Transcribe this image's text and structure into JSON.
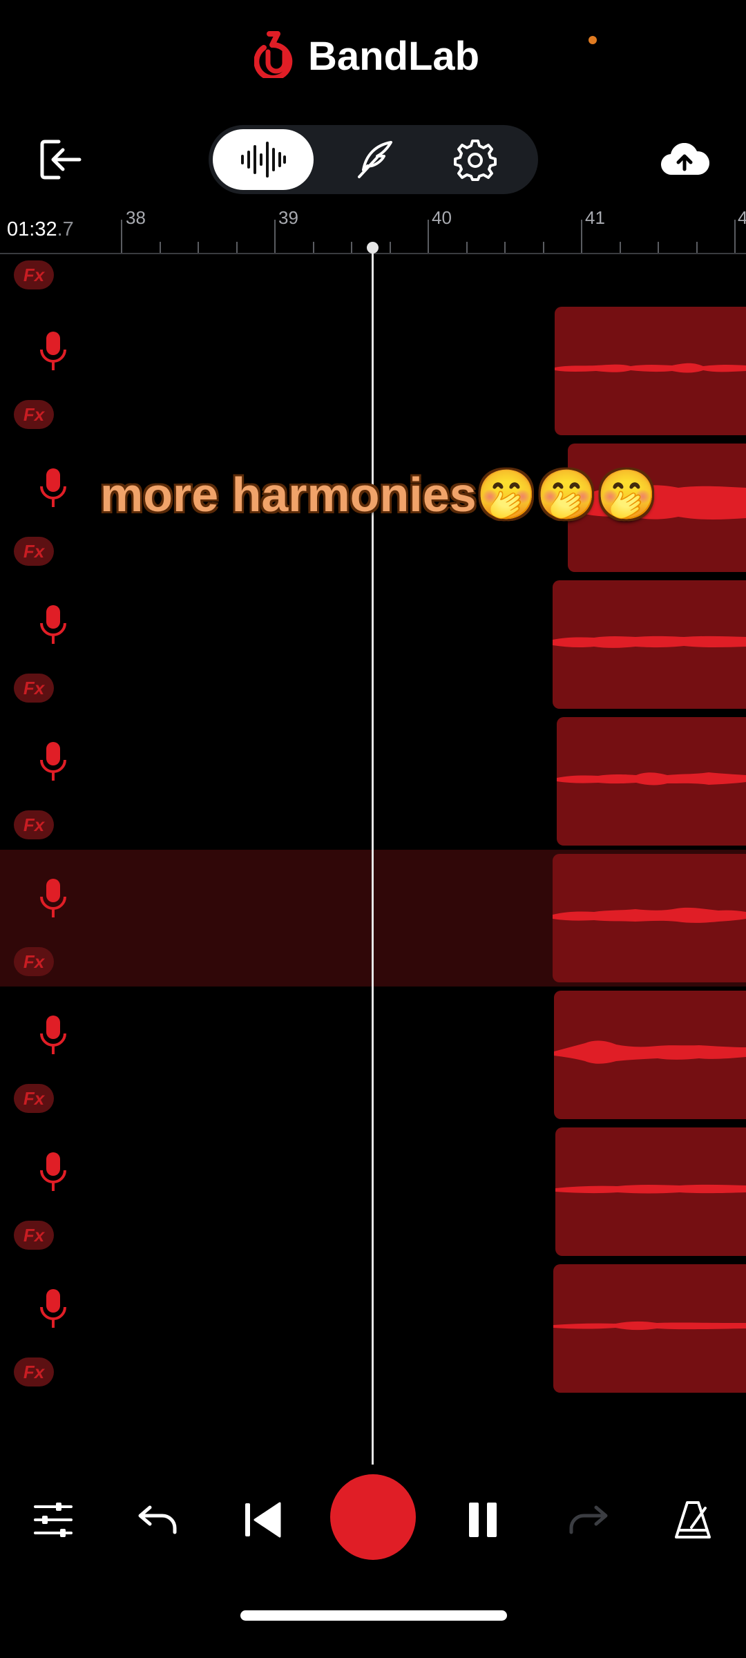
{
  "header": {
    "app_name": "BandLab",
    "mode_tabs": [
      {
        "name": "tracks",
        "icon": "waveform-icon",
        "active": true
      },
      {
        "name": "lyrics",
        "icon": "quill-pen-icon",
        "active": false
      },
      {
        "name": "settings",
        "icon": "gear-icon",
        "active": false
      }
    ],
    "left_action_icon": "exit-icon",
    "right_action_icon": "cloud-upload-icon"
  },
  "timeline": {
    "time_main": "01:32",
    "time_fraction": ".7",
    "bars": [
      "38",
      "39",
      "40",
      "41",
      "4"
    ]
  },
  "tracks": {
    "fx_label": "Fx",
    "count": 9,
    "selected_index": 5,
    "track_type_icon": "microphone-icon"
  },
  "overlay": {
    "caption": "more harmonies🤭🤭🤭"
  },
  "transport": {
    "buttons": [
      "mixer-sliders-icon",
      "undo-icon",
      "skip-back-icon",
      "record-button",
      "pause-icon",
      "redo-icon",
      "metronome-icon"
    ]
  },
  "colors": {
    "accent": "#e01e26",
    "clip_fill": "#750f12",
    "selected_track": "#300708",
    "caption_text": "#f0a36a"
  }
}
